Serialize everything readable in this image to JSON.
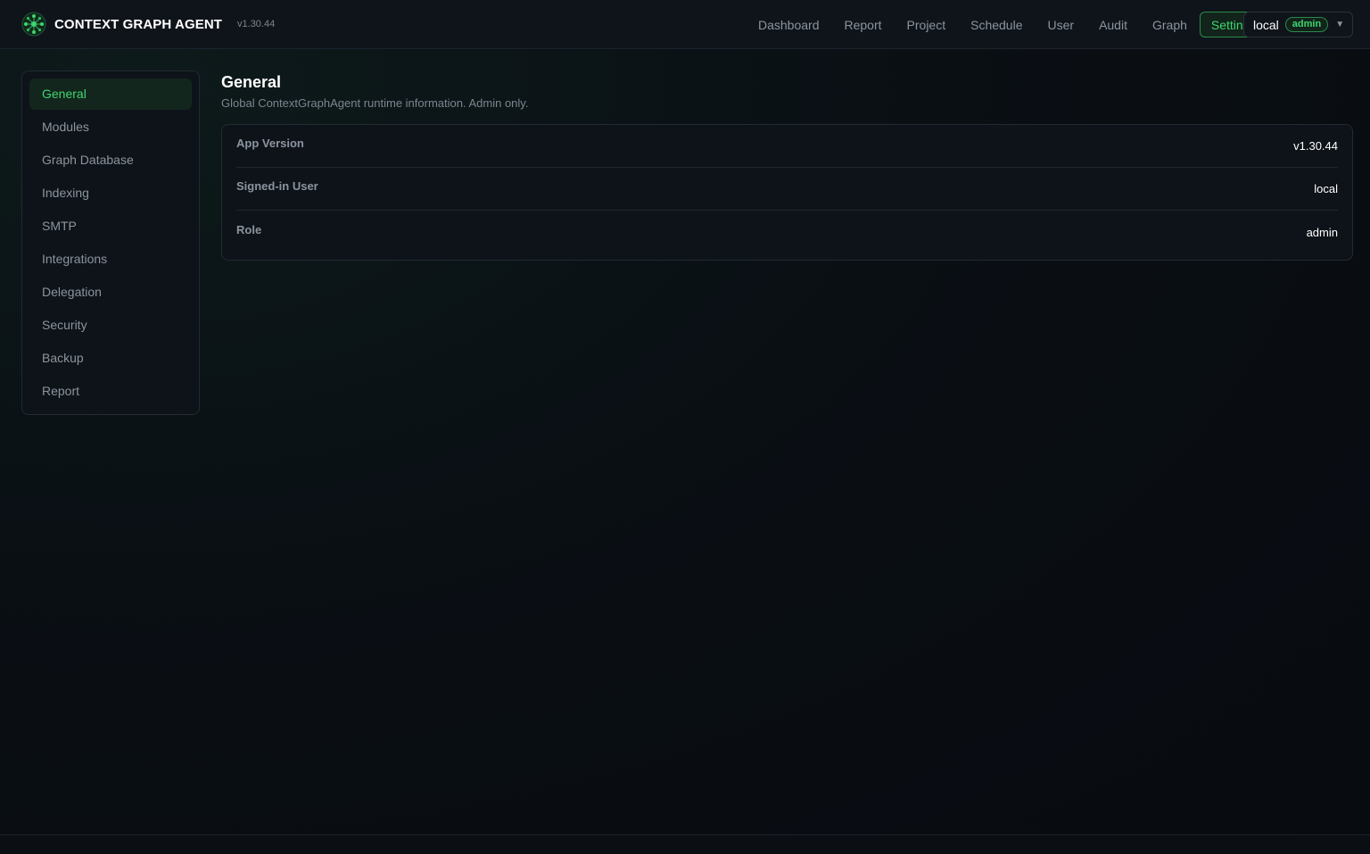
{
  "header": {
    "brand": "CONTEXT GRAPH AGENT",
    "version": "v1.30.44",
    "logo_icon": "graph-network-icon",
    "nav": [
      {
        "label": "Dashboard",
        "active": false
      },
      {
        "label": "Report",
        "active": false
      },
      {
        "label": "Project",
        "active": false
      },
      {
        "label": "Schedule",
        "active": false
      },
      {
        "label": "User",
        "active": false
      },
      {
        "label": "Audit",
        "active": false
      },
      {
        "label": "Graph",
        "active": false
      },
      {
        "label": "Settings",
        "active": true
      }
    ],
    "user": {
      "name": "local",
      "role": "admin",
      "caret": "▼"
    }
  },
  "sidebar": {
    "items": [
      {
        "label": "General",
        "active": true
      },
      {
        "label": "Modules",
        "active": false
      },
      {
        "label": "Graph Database",
        "active": false
      },
      {
        "label": "Indexing",
        "active": false
      },
      {
        "label": "SMTP",
        "active": false
      },
      {
        "label": "Integrations",
        "active": false
      },
      {
        "label": "Delegation",
        "active": false
      },
      {
        "label": "Security",
        "active": false
      },
      {
        "label": "Backup",
        "active": false
      },
      {
        "label": "Report",
        "active": false
      }
    ]
  },
  "main": {
    "title": "General",
    "subtitle": "Global ContextGraphAgent runtime information. Admin only.",
    "rows": [
      {
        "label": "App Version",
        "value": "v1.30.44"
      },
      {
        "label": "Signed-in User",
        "value": "local"
      },
      {
        "label": "Role",
        "value": "admin"
      }
    ]
  },
  "colors": {
    "accent": "#3fd66f",
    "background": "#0a0f14",
    "panel": "#0e1319"
  }
}
